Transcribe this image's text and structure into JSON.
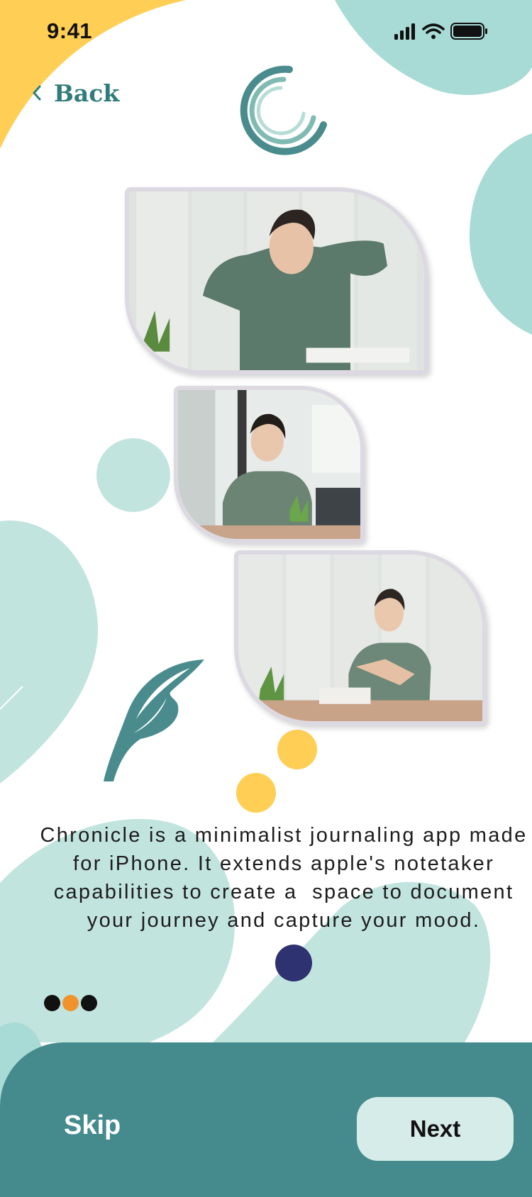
{
  "status_bar": {
    "time": "9:41"
  },
  "nav": {
    "back_label": "Back"
  },
  "onboarding": {
    "description_lines": [
      "Chronicle is a minimalist journaling app made",
      "for iPhone. It extends apple's notetaker",
      "capabilities to create a  space to document",
      "your journey and capture your mood."
    ],
    "page_indicator": {
      "total": 3,
      "current": 2
    },
    "images": [
      "woman-stretching-at-desk",
      "woman-on-phone-at-desk",
      "woman-stretching-arms-at-desk"
    ]
  },
  "footer": {
    "skip_label": "Skip",
    "next_label": "Next"
  },
  "colors": {
    "teal_dark": "#458b8e",
    "teal_light": "#a8dbd5",
    "mint_button": "#d6ece8",
    "yellow": "#ffce54",
    "navy": "#2e3270",
    "orange_dot": "#f0932d"
  },
  "icons": {
    "signal": "cellular-signal-icon",
    "wifi": "wifi-icon",
    "battery": "battery-icon",
    "back": "chevron-left-icon",
    "logo": "chronicle-ring-logo",
    "feather": "feather-quill-icon"
  }
}
